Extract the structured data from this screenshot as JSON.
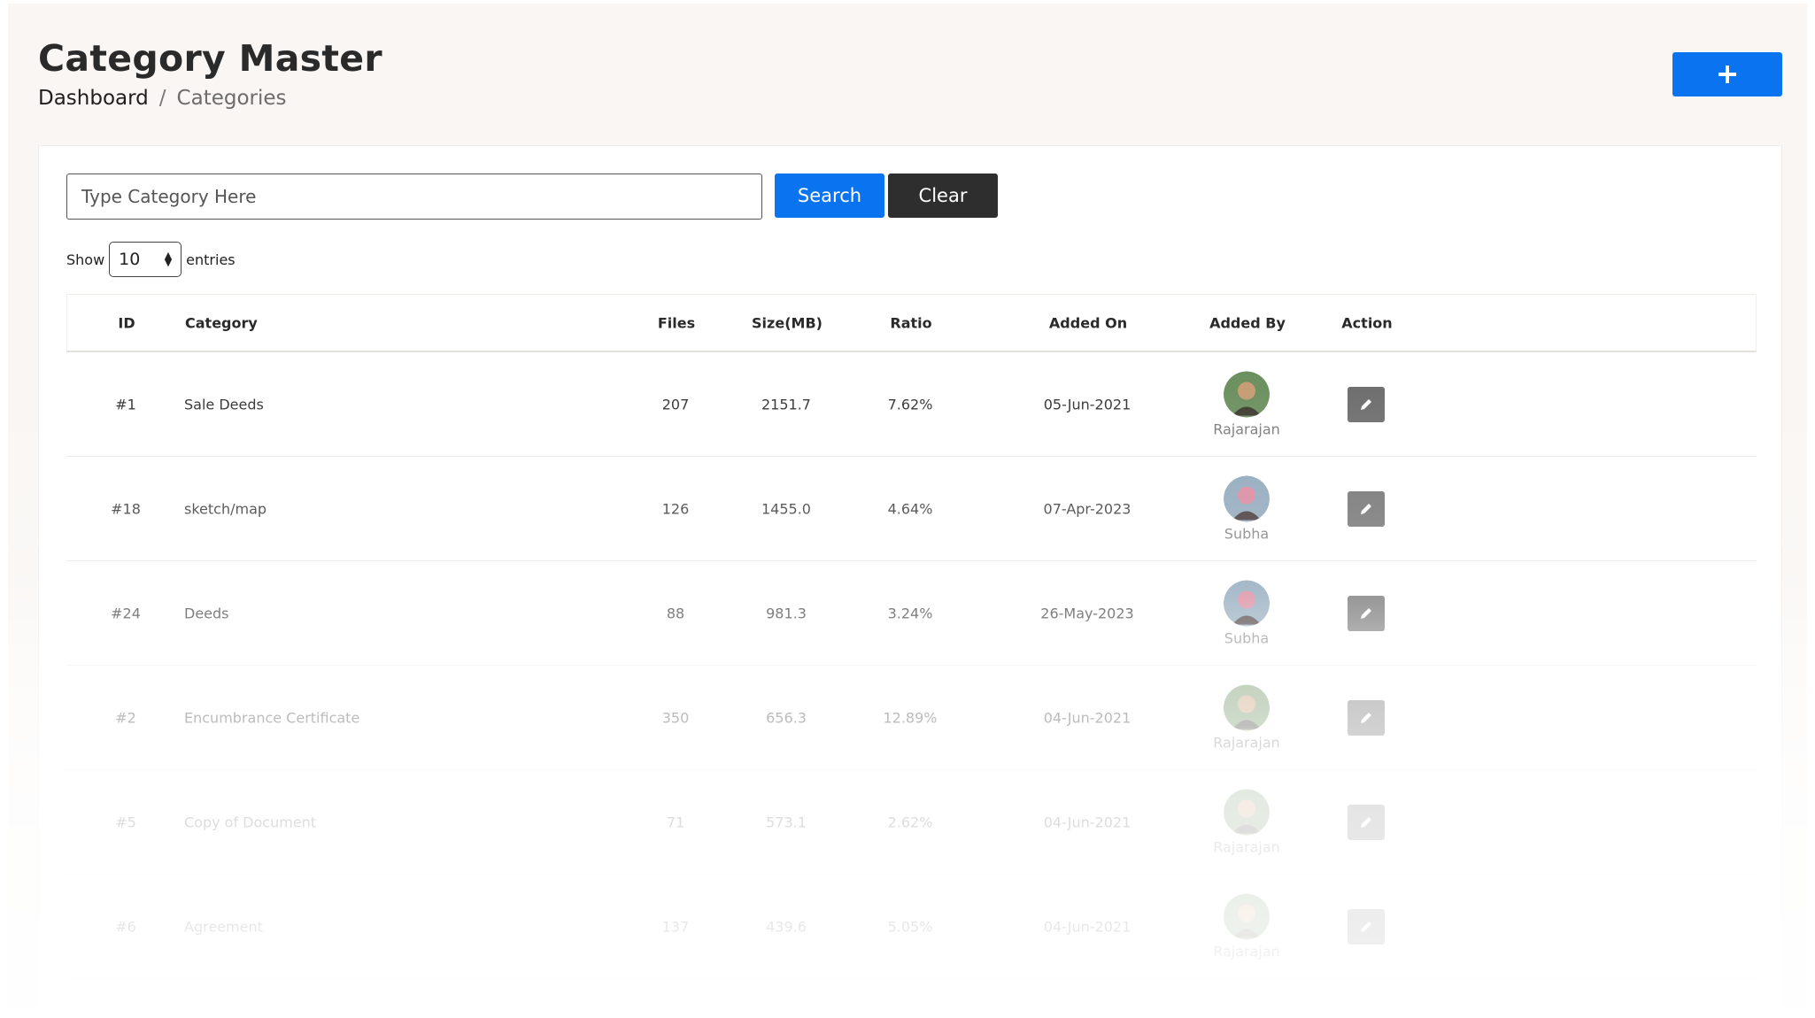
{
  "header": {
    "title": "Category Master",
    "breadcrumb": {
      "home": "Dashboard",
      "separator": "/",
      "current": "Categories"
    },
    "add_button_icon": "plus-icon"
  },
  "search": {
    "placeholder": "Type Category Here",
    "value": "",
    "search_label": "Search",
    "clear_label": "Clear"
  },
  "length_control": {
    "show_label": "Show",
    "value": "10",
    "entries_label": "entries"
  },
  "table": {
    "columns": [
      "ID",
      "Category",
      "Files",
      "Size(MB)",
      "Ratio",
      "Added On",
      "Added By",
      "Action"
    ],
    "rows": [
      {
        "id": "#1",
        "category": "Sale Deeds",
        "files": "207",
        "size": "2151.7",
        "ratio": "7.62%",
        "added_on": "05-Jun-2021",
        "added_by": "Rajarajan"
      },
      {
        "id": "#18",
        "category": "sketch/map",
        "files": "126",
        "size": "1455.0",
        "ratio": "4.64%",
        "added_on": "07-Apr-2023",
        "added_by": "Subha"
      },
      {
        "id": "#24",
        "category": "Deeds",
        "files": "88",
        "size": "981.3",
        "ratio": "3.24%",
        "added_on": "26-May-2023",
        "added_by": "Subha"
      },
      {
        "id": "#2",
        "category": "Encumbrance Certificate",
        "files": "350",
        "size": "656.3",
        "ratio": "12.89%",
        "added_on": "04-Jun-2021",
        "added_by": "Rajarajan"
      },
      {
        "id": "#5",
        "category": "Copy of Document",
        "files": "71",
        "size": "573.1",
        "ratio": "2.62%",
        "added_on": "04-Jun-2021",
        "added_by": "Rajarajan"
      },
      {
        "id": "#6",
        "category": "Agreement",
        "files": "137",
        "size": "439.6",
        "ratio": "5.05%",
        "added_on": "04-Jun-2021",
        "added_by": "Rajarajan"
      }
    ]
  },
  "colors": {
    "primary": "#0a73f0",
    "dark_button": "#2e2e2e",
    "edit_button": "#6c6c6c",
    "page_bg": "#f9f6f3"
  }
}
